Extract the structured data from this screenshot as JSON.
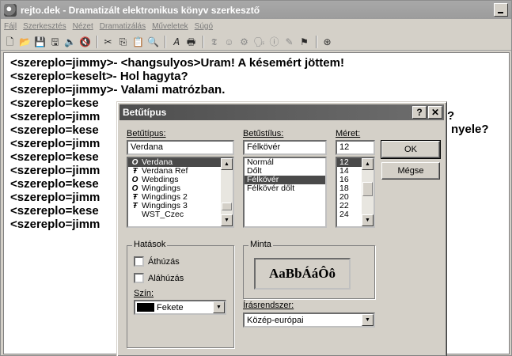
{
  "window": {
    "title": "rejto.dek - Dramatizált elektronikus könyv szerkesztő"
  },
  "menu": [
    "Fájl",
    "Szerkesztés",
    "Nézet",
    "Dramatizálás",
    "Műveletek",
    "Súgó"
  ],
  "toolbar": {
    "buttons": [
      {
        "name": "new-file-icon",
        "glyph": "🗋"
      },
      {
        "name": "open-folder-icon",
        "glyph": "📂"
      },
      {
        "name": "save-icon",
        "glyph": "💾"
      },
      {
        "name": "save-all-icon",
        "glyph": "🖫"
      },
      {
        "name": "speaker-icon",
        "glyph": "🔈"
      },
      {
        "name": "stop-speaker-icon",
        "glyph": "🔇"
      },
      {
        "name": "cut-icon",
        "glyph": "✂"
      },
      {
        "name": "copy-icon",
        "glyph": "⎘"
      },
      {
        "name": "paste-icon",
        "glyph": "📋"
      },
      {
        "name": "find-icon",
        "glyph": "🔍"
      },
      {
        "name": "font-icon",
        "glyph": "𝐴"
      },
      {
        "name": "print-icon",
        "glyph": "🖶"
      },
      {
        "name": "format-icon",
        "glyph": "𝕿"
      },
      {
        "name": "emoticon-icon",
        "glyph": "☺"
      },
      {
        "name": "settings-icon",
        "glyph": "⚙"
      },
      {
        "name": "voice-icon",
        "glyph": "🗣"
      },
      {
        "name": "info-icon",
        "glyph": "ⓘ"
      },
      {
        "name": "tools-icon",
        "glyph": "✎"
      },
      {
        "name": "filter-icon",
        "glyph": "⚑"
      },
      {
        "name": "help-icon",
        "glyph": "⊛"
      }
    ]
  },
  "editor": {
    "lines": [
      "<szereplo=jimmy>- <hangsulyos>Uram! A késemért jöttem!",
      "<szereplo=keselt>- Hol hagyta?",
      "<szereplo=jimmy>- Valami matrózban.",
      "<szereplo=kese",
      "<szereplo=jimm",
      "<szereplo=kese",
      "<szereplo=jimm",
      "<szereplo=kese",
      "<szereplo=jimm",
      "<szereplo=kese",
      "<szereplo=jimm",
      "<szereplo=kese",
      "<szereplo=jimm"
    ],
    "fragment_1": "?",
    "fragment_2": "nyele?"
  },
  "dialog": {
    "title": "Betűtípus",
    "font_label": "Betűtípus:",
    "font_value": "Verdana",
    "font_list": [
      {
        "label": "Verdana",
        "selected": true,
        "glyph": "O"
      },
      {
        "label": "Verdana Ref",
        "selected": false,
        "glyph": "Ŧ"
      },
      {
        "label": "Webdings",
        "selected": false,
        "glyph": "O"
      },
      {
        "label": "Wingdings",
        "selected": false,
        "glyph": "O"
      },
      {
        "label": "Wingdings 2",
        "selected": false,
        "glyph": "Ŧ"
      },
      {
        "label": "Wingdings 3",
        "selected": false,
        "glyph": "Ŧ"
      },
      {
        "label": "WST_Czec",
        "selected": false,
        "glyph": ""
      }
    ],
    "style_label": "Betűstílus:",
    "style_value": "Félkövér",
    "style_list": [
      {
        "label": "Normál",
        "selected": false
      },
      {
        "label": "Dőlt",
        "selected": false
      },
      {
        "label": "Félkövér",
        "selected": true
      },
      {
        "label": "Félkövér dőlt",
        "selected": false
      }
    ],
    "size_label": "Méret:",
    "size_value": "12",
    "size_list": [
      {
        "label": "12",
        "selected": true
      },
      {
        "label": "14",
        "selected": false
      },
      {
        "label": "16",
        "selected": false
      },
      {
        "label": "18",
        "selected": false
      },
      {
        "label": "20",
        "selected": false
      },
      {
        "label": "22",
        "selected": false
      },
      {
        "label": "24",
        "selected": false
      }
    ],
    "ok_label": "OK",
    "cancel_label": "Mégse",
    "effects_title": "Hatások",
    "strikeout_label": "Áthúzás",
    "underline_label": "Aláhúzás",
    "color_label": "Szín:",
    "color_value": "Fekete",
    "preview_title": "Minta",
    "preview_text": "AaBbÁáÔô",
    "script_label": "Írásrendszer:",
    "script_value": "Közép-európai"
  }
}
